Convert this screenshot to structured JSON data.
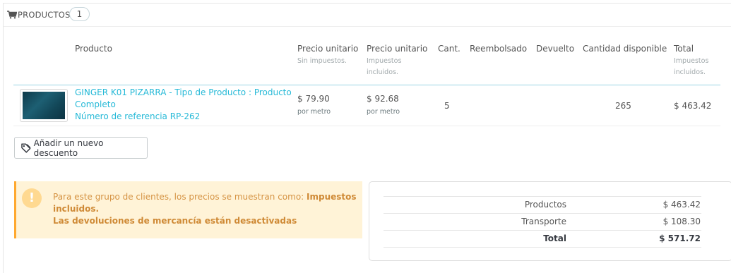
{
  "panel": {
    "title": "PRODUCTOS",
    "count": "1",
    "icon": "shopping-cart-icon"
  },
  "table": {
    "columns": [
      {
        "label": "Producto",
        "sub": ""
      },
      {
        "label": "Precio unitario",
        "sub": "Sin impuestos."
      },
      {
        "label": "Precio unitario",
        "sub_lines": [
          "Impuestos",
          "incluidos."
        ]
      },
      {
        "label": "Cant.",
        "sub": ""
      },
      {
        "label": "Reembolsado",
        "sub": ""
      },
      {
        "label": "Devuelto",
        "sub": ""
      },
      {
        "label": "Cantidad disponible",
        "sub": ""
      },
      {
        "label": "Total",
        "sub_lines": [
          "Impuestos",
          "incluidos."
        ]
      }
    ],
    "rows": [
      {
        "name_lines": [
          "GINGER K01 PIZARRA - Tipo de Producto : Producto",
          "Completo"
        ],
        "reference": "Número de referencia RP-262",
        "price_excl": "$ 79.90",
        "price_excl_unit": "por metro",
        "price_incl": "$ 92.68",
        "price_incl_unit": "por metro",
        "quantity": "5",
        "refunded": "",
        "returned": "",
        "available": "265",
        "total": "$ 463.42"
      }
    ]
  },
  "actions": {
    "add_discount_label": "Añadir un nuevo descuento",
    "add_discount_icon": "tag-icon"
  },
  "alert": {
    "icon": "warning-icon",
    "text_prefix": "Para este grupo de clientes, los precios se muestran como: ",
    "text_bold_1": "Impuestos",
    "text_bold_2": "incluidos.",
    "text_line_3": "Las devoluciones de mercancía están desactivadas",
    "bg_color": "#fff3d7",
    "border_color": "#ffa82f"
  },
  "totals": {
    "rows": [
      {
        "label": "Productos",
        "value": "$ 463.42"
      },
      {
        "label": "Transporte",
        "value": "$ 108.30"
      },
      {
        "label": "Total",
        "value": "$ 571.72"
      }
    ]
  },
  "colors": {
    "link": "#25b9d7",
    "text": "#555555"
  }
}
